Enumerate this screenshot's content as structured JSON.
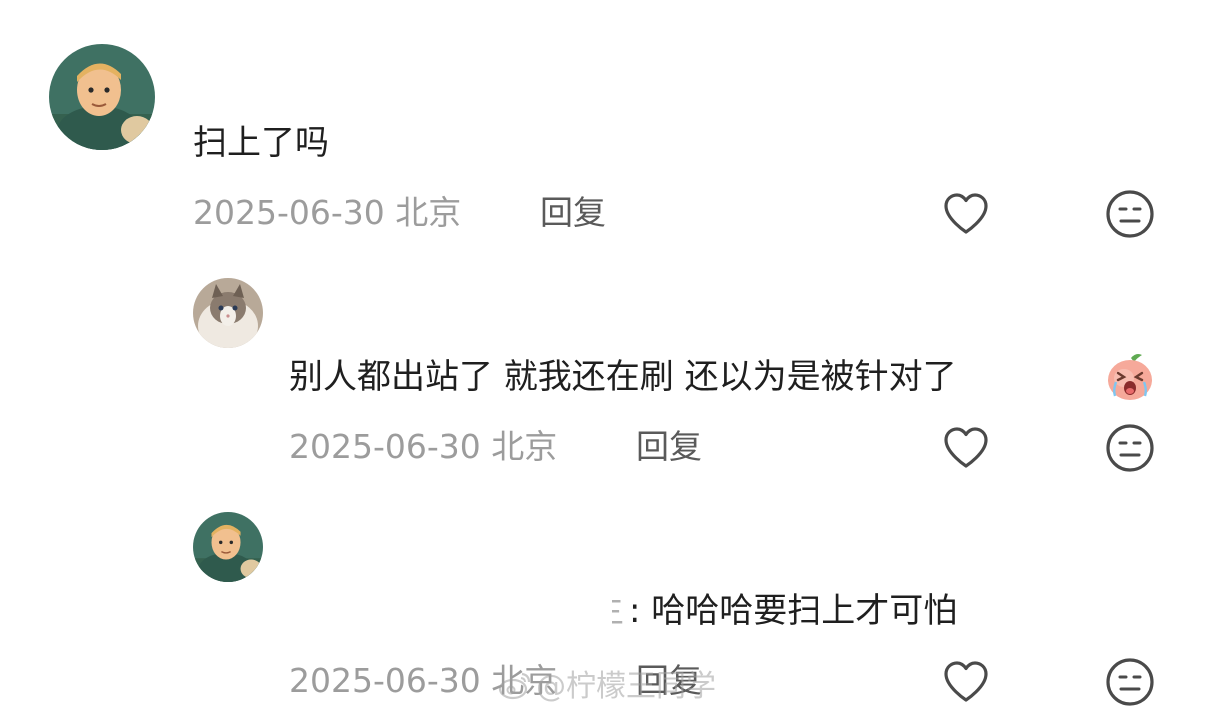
{
  "comments": [
    {
      "text": "扫上了吗",
      "date": "2025-06-30 北京",
      "reply_label": "回复"
    },
    {
      "text": "别人都出站了 就我还在刷 还以为是被针对了",
      "date": "2025-06-30 北京",
      "reply_label": "回复",
      "sticker": "crying-peach-emoji"
    },
    {
      "partial_name": "主",
      "text": ": 哈哈哈要扫上才可怕",
      "date": "2025-06-30 北京",
      "reply_label": "回复"
    }
  ],
  "watermark": "@柠檬王同学",
  "icons": {
    "like": "heart-icon",
    "dislike": "meh-face-icon",
    "weibo": "weibo-logo-icon"
  },
  "colors": {
    "text": "#1f1f1f",
    "meta": "#9c9c9c",
    "reply": "#5a5a5a",
    "icon": "#4a4a4a"
  }
}
